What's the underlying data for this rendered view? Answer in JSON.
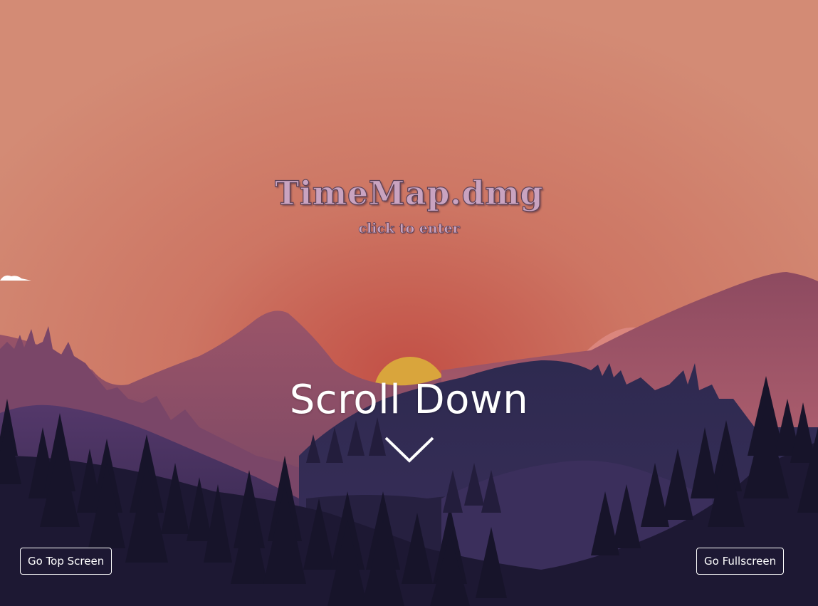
{
  "hero": {
    "title": "TimeMap.dmg",
    "subtitle": "click to enter"
  },
  "scroll_prompt": {
    "label": "Scroll Down",
    "icon": "chevron-down-icon"
  },
  "controls": {
    "go_top_label": "Go Top Screen",
    "fullscreen_label": "Go Fullscreen"
  },
  "colors": {
    "sky_top": "#d28a74",
    "sky_glow": "#c65a4a",
    "sun": "#d9a53c",
    "title_fill": "#c9a3c0",
    "title_outline": "#5b4258",
    "text_white": "#ffffff",
    "foreground_trees": "#1a1630"
  }
}
